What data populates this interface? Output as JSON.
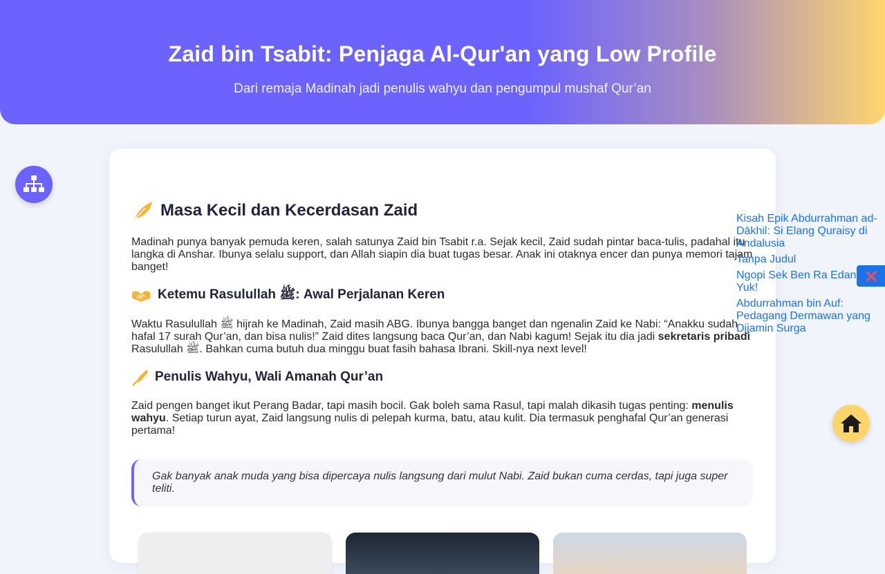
{
  "hero": {
    "title": "Zaid bin Tsabit: Penjaga Al-Qur'an yang Low Profile",
    "subtitle": "Dari remaja Madinah jadi penulis wahyu dan pengumpul mushaf Qur’an"
  },
  "colors": {
    "accent": "#6c63ff",
    "gold": "#ffd56b",
    "link": "#1a73e8"
  },
  "sections": [
    {
      "icon": "feather-icon",
      "title": "Masa Kecil dan Kecerdasan Zaid",
      "body": "Madinah punya banyak pemuda keren, salah satunya Zaid bin Tsabit r.a. Sejak kecil, Zaid sudah pintar baca-tulis, padahal itu langka di Anshar. Ibunya selalu support, dan Allah siapin dia buat tugas besar. Anak ini otaknya encer dan punya memori tajam banget!"
    },
    {
      "icon": "handshake-icon",
      "title": "Ketemu Rasulullah ﷺ: Awal Perjalanan Keren",
      "body_a": "Waktu Rasulullah ﷺ hijrah ke Madinah, Zaid masih ABG. Ibunya bangga banget dan ngenalin Zaid ke Nabi: “Anakku sudah hafal 17 surah Qur’an, dan bisa nulis!” Zaid dites langsung baca Qur’an, dan Nabi kagum! Sejak itu dia jadi ",
      "body_bold": "sekretaris pribadi",
      "body_b": " Rasulullah ﷺ. Bahkan cuma butuh dua minggu buat fasih bahasa Ibrani. Skill-nya next level!"
    },
    {
      "icon": "pen-icon",
      "title": "Penulis Wahyu, Wali Amanah Qur’an",
      "body_a": "Zaid pengen banget ikut Perang Badar, tapi masih bocil. Gak boleh sama Rasul, tapi malah dikasih tugas penting: ",
      "body_bold": "menulis wahyu",
      "body_b": ". Setiap turun ayat, Zaid langsung nulis di pelepah kurma, batu, atau kulit. Dia termasuk penghafal Qur’an generasi pertama!"
    }
  ],
  "quote": "Gak banyak anak muda yang bisa dipercaya nulis langsung dari mulut Nabi. Zaid bukan cuma cerdas, tapi juga super teliti.",
  "side_links": [
    "Kisah Epik Abdurrahman ad-Dākhil: Si Elang Quraisy di Andalusia",
    "Tanpa Judul",
    "Ngopi Sek Ben Ra Edan Yuk!",
    "Abdurrahman bin Auf: Pedagang Dermawan yang Dijamin Surga"
  ],
  "buttons": {
    "sitemap_icon": "sitemap-icon",
    "close_icon": "close-icon",
    "home_icon": "home-icon"
  }
}
